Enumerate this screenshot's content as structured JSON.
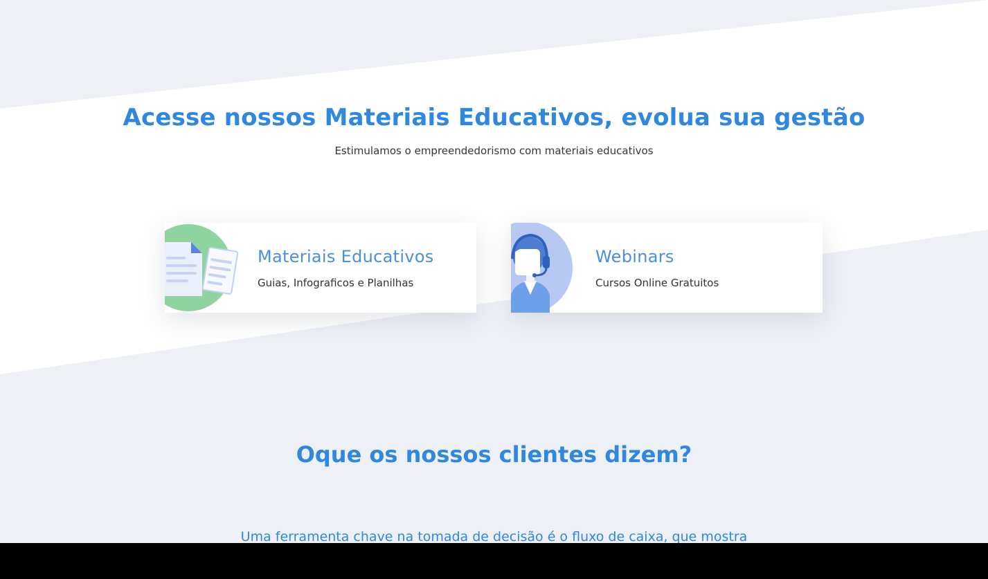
{
  "hero": {
    "title": "Acesse nossos Materiais Educativos, evolua sua gestão",
    "subtitle": "Estimulamos o empreendedorismo com materiais educativos"
  },
  "cards": [
    {
      "title": "Materiais Educativos",
      "description": "Guias, Infograficos e Planilhas",
      "icon": "documents-icon"
    },
    {
      "title": "Webinars",
      "description": "Cursos Online Gratuitos",
      "icon": "support-agent-icon"
    }
  ],
  "testimonials": {
    "title": "Oque os nossos clientes dizem?",
    "quote": "Uma ferramenta chave na tomada de decisão é o fluxo de caixa, que mostra"
  },
  "colors": {
    "accent": "#2f87e0",
    "card_title": "#4a8fdc",
    "background": "#edf1f6",
    "band": "#ffffff",
    "green_circle": "#8fd3a0",
    "blue_circle": "#b7c9f3"
  }
}
